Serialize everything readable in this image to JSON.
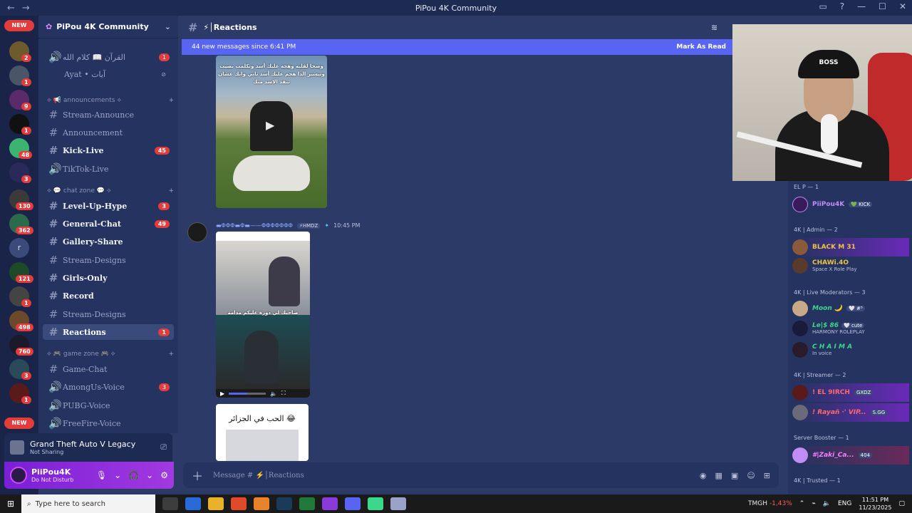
{
  "window": {
    "title": "PiPou 4K Community",
    "nav_back": "←",
    "nav_forward": "→"
  },
  "rail": {
    "top_badge": "NEW",
    "bottom_badge": "NEW",
    "servers": [
      {
        "badge": "1"
      },
      {
        "badge": "2"
      },
      {
        "badge": "1"
      },
      {
        "badge": "9"
      },
      {
        "badge": "1"
      },
      {
        "badge": "48"
      },
      {
        "badge": "3"
      },
      {
        "badge": "130"
      },
      {
        "badge": "362"
      },
      {
        "badge": ""
      },
      {
        "badge": "121"
      },
      {
        "badge": "1"
      },
      {
        "badge": "498"
      },
      {
        "badge": "760"
      },
      {
        "badge": "3"
      },
      {
        "badge": "1"
      }
    ],
    "letter_server": "r"
  },
  "guild": {
    "name": "PiPou 4K Community",
    "voice_channels_top": [
      {
        "name": "القرآن 📖 كلام الله",
        "count": "1"
      },
      {
        "name": "Ayat • آيات",
        "count": ""
      }
    ],
    "categories": {
      "announcements": "⟡ 📢 announcements ⟡",
      "chat_zone": "⟡ 💬 chat zone 💬 ⟡",
      "game_zone": "⟡ 🎮 game zone 🎮 ⟡"
    },
    "channels": [
      {
        "name": "Stream-Announce",
        "count": ""
      },
      {
        "name": "Announcement",
        "count": ""
      },
      {
        "name": "Kick-Live",
        "count": "45"
      },
      {
        "name": "TikTok-Live",
        "count": ""
      },
      {
        "name": "Level-Up-Hype",
        "count": "3"
      },
      {
        "name": "General-Chat",
        "count": "49"
      },
      {
        "name": "Gallery-Share",
        "count": ""
      },
      {
        "name": "Stream-Designs",
        "count": ""
      },
      {
        "name": "Girls-Only",
        "count": ""
      },
      {
        "name": "Record",
        "count": ""
      },
      {
        "name": "Stream-Designs",
        "count": ""
      },
      {
        "name": "Reactions",
        "count": "1"
      },
      {
        "name": "Game-Chat",
        "count": ""
      },
      {
        "name": "AmongUs-Voice",
        "count": "3"
      },
      {
        "name": "PUBG-Voice",
        "count": ""
      },
      {
        "name": "FreeFire-Voice",
        "count": ""
      }
    ]
  },
  "activity": {
    "game": "Grand Theft Auto V Legacy",
    "status": "Not Sharing"
  },
  "user": {
    "name": "PiiPou4K",
    "status": "Do Not Disturb"
  },
  "chat": {
    "channel": "⚡│Reactions",
    "banner": "44 new messages since 6:41 PM",
    "banner_action": "Mark As Read",
    "media1_caption": "وصحا لقلبه وهجه عليك أسد وتكلمت بصيت وتبشير الذا هجم عليك أسد ثاني وانك عشان تنقذ الاسد منك",
    "message": {
      "author": "▬ΦΦΦ▬Φ▬——ΦΦΦΦΦΦΦ",
      "tag": "⚡HMDZ",
      "time": "10:45 PM"
    },
    "media2_caption": "صاحبك لي دورة عليكم مدامة",
    "media3_text": "الحب في الجزائر 😂",
    "video_progress": 0.5,
    "composer_placeholder": "Message # ⚡│Reactions"
  },
  "members": {
    "groups": [
      {
        "title": "EL P — 1"
      },
      {
        "title": "4K | Admin — 2"
      },
      {
        "title": "4K | Live Moderators — 3"
      },
      {
        "title": "4K | Streamer — 2"
      },
      {
        "title": "Server Booster — 1"
      },
      {
        "title": "4K | Trusted — 1"
      }
    ],
    "list": [
      {
        "name": "PiiPou4K",
        "sub": "",
        "pill": "💚 KICK",
        "color": "#c28cf7"
      },
      {
        "name": "BLACK M 31",
        "sub": "",
        "pill": "",
        "color": "#f0c246"
      },
      {
        "name": "CHAWi.4O",
        "sub": "Space X Role Play",
        "pill": "",
        "color": "#f0c246"
      },
      {
        "name": "Moon 🌙",
        "sub": "",
        "pill": "🤍 #⁵",
        "color": "#3dd68c"
      },
      {
        "name": "Le|$ 86",
        "sub": "HARMONY ROLEPLAY",
        "pill": "🤍 cute",
        "color": "#3dd68c"
      },
      {
        "name": "C H A I M A",
        "sub": "In voice",
        "pill": "",
        "color": "#3dd68c"
      },
      {
        "name": "! EL 9IRCH",
        "sub": "",
        "pill": "GXDZ",
        "color": "#ff6a6a"
      },
      {
        "name": "! Rayañ ·' VIP...",
        "sub": "",
        "pill": "S.GG",
        "color": "#ff6a6a"
      },
      {
        "name": "#|Zaki_Ca...",
        "sub": "",
        "pill": "404",
        "color": "#f47fff"
      }
    ]
  },
  "webcam": {
    "cap_text": "BOSS"
  },
  "taskbar": {
    "search_placeholder": "Type here to search",
    "ticker_name": "TMGH",
    "ticker_change": "-1,43%",
    "lang": "ENG",
    "time": "11:51 PM",
    "date": "11/23/2025"
  }
}
